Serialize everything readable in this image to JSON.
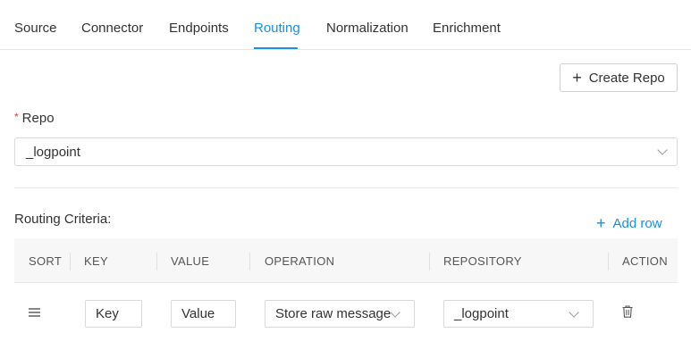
{
  "tabs": [
    {
      "label": "Source"
    },
    {
      "label": "Connector"
    },
    {
      "label": "Endpoints"
    },
    {
      "label": "Routing",
      "active": true
    },
    {
      "label": "Normalization"
    },
    {
      "label": "Enrichment"
    }
  ],
  "toolbar": {
    "create_repo_label": "Create Repo"
  },
  "repo": {
    "label": "Repo",
    "required_mark": "*",
    "selected": "_logpoint"
  },
  "routing": {
    "title": "Routing Criteria:",
    "add_row_label": "Add row",
    "columns": [
      "SORT",
      "KEY",
      "VALUE",
      "OPERATION",
      "REPOSITORY",
      "ACTION"
    ],
    "rows": [
      {
        "key_placeholder": "Key",
        "value_placeholder": "Value",
        "operation": "Store raw message",
        "repository": "_logpoint"
      }
    ]
  },
  "colors": {
    "accent": "#1a8fe3",
    "required": "#e53935"
  },
  "icons": {
    "create": "plus-icon",
    "add_row": "plus-icon",
    "sort": "drag-handle-icon",
    "action": "trash-icon",
    "dropdown": "chevron-down-icon"
  }
}
